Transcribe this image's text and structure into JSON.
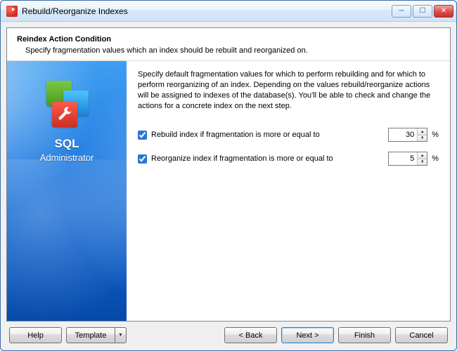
{
  "window": {
    "title": "Rebuild/Reorganize Indexes"
  },
  "header": {
    "heading": "Reindex Action Condition",
    "subheading": "Specify fragmentation values which an index should be rebuilt and reorganized on."
  },
  "sidebar": {
    "product_name": "SQL",
    "product_sub": "Administrator"
  },
  "main": {
    "description": "Specify default fragmentation values for which to perform rebuilding and for which to perform reorganizing of an index. Depending on the values rebuild/reorganize actions will be assigned to indexes of the database(s). You'll be able to check and change the actions for a concrete index on the next step.",
    "rebuild": {
      "label": "Rebuild index if fragmentation is more or equal to",
      "value": "30",
      "suffix": "%"
    },
    "reorganize": {
      "label": "Reorganize index if fragmentation is more or equal to",
      "value": "5",
      "suffix": "%"
    }
  },
  "buttons": {
    "help": "Help",
    "template": "Template",
    "back": "< Back",
    "next": "Next >",
    "finish": "Finish",
    "cancel": "Cancel"
  },
  "icons": {
    "minimize": "─",
    "maximize": "☐",
    "close": "✕",
    "spin_up": "▲",
    "spin_down": "▼",
    "dropdown": "▼"
  }
}
